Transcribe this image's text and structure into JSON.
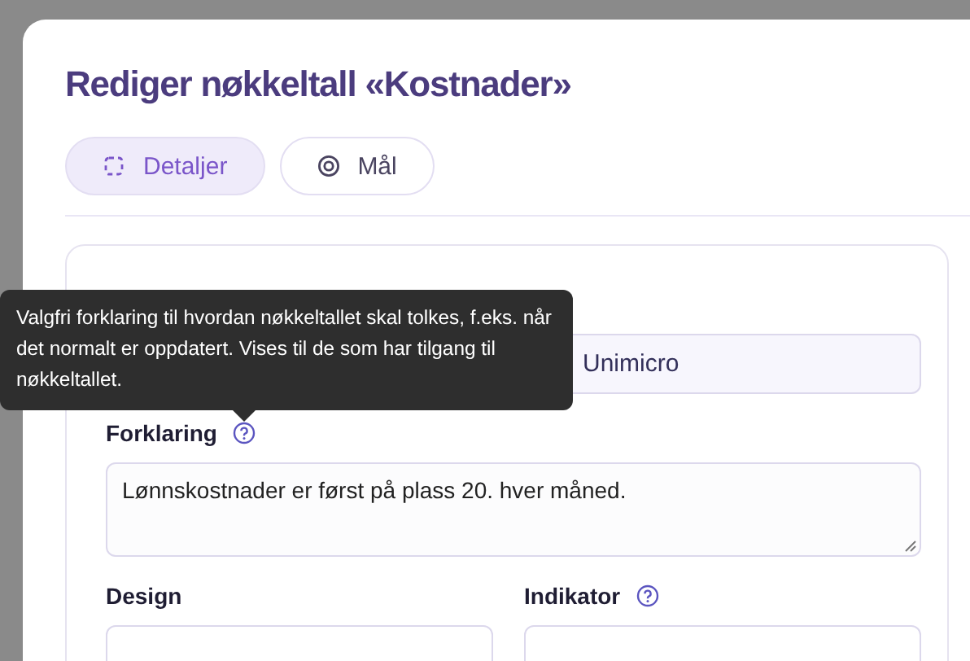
{
  "dialog": {
    "title": "Rediger nøkkeltall «Kostnader»",
    "tabs": [
      {
        "label": "Detaljer",
        "selected": true
      },
      {
        "label": "Mål",
        "selected": false
      }
    ],
    "fields": [
      {
        "kind": "source",
        "value": "Unimicro"
      },
      {
        "kind": "textarea",
        "label": "Forklaring",
        "help": true,
        "value": "Lønnskostnader er først på plass 20. hver måned."
      },
      {
        "kind": "cut",
        "label": "Design",
        "help": false
      },
      {
        "kind": "cut",
        "label": "Indikator",
        "help": true
      }
    ],
    "tooltip": {
      "text": "Valgfri forklaring til hvordan nøkkeltallet skal tolkes, f.eks. når det normalt er oppdatert. Vises til de som har tilgang til nøkkeltallet."
    }
  }
}
